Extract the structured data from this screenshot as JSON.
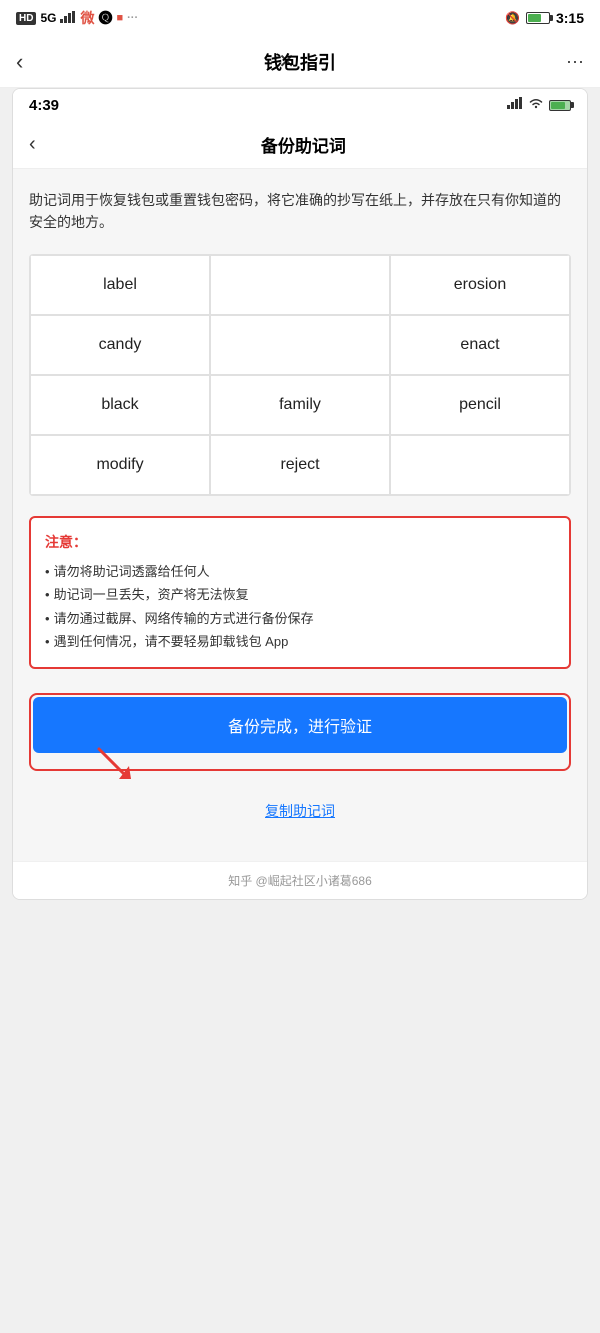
{
  "outer": {
    "status": {
      "time": "3:15",
      "indicators": [
        "HD",
        "5G",
        "signal"
      ]
    },
    "nav": {
      "title": "钱包指引",
      "back_label": "‹",
      "close_label": "✕",
      "more_label": "···"
    }
  },
  "inner": {
    "status": {
      "time": "4:39"
    },
    "nav": {
      "title": "备份助记词",
      "back_label": "‹"
    },
    "description": "助记词用于恢复钱包或重置钱包密码，将它准确的抄写在纸上，并存放在只有你知道的安全的地方。",
    "mnemonic_words": [
      {
        "word": "label",
        "col": 0
      },
      {
        "word": "",
        "col": 1
      },
      {
        "word": "erosion",
        "col": 2
      },
      {
        "word": "candy",
        "col": 0
      },
      {
        "word": "",
        "col": 1
      },
      {
        "word": "enact",
        "col": 2
      },
      {
        "word": "black",
        "col": 0
      },
      {
        "word": "family",
        "col": 1
      },
      {
        "word": "pencil",
        "col": 2
      },
      {
        "word": "modify",
        "col": 0
      },
      {
        "word": "reject",
        "col": 1
      },
      {
        "word": "",
        "col": 2
      }
    ],
    "warning": {
      "title": "注意：",
      "items": [
        "请勿将助记词透露给任何人",
        "助记词一旦丢失，资产将无法恢复",
        "请勿通过截屏、网络传输的方式进行备份保存",
        "遇到任何情况，请不要轻易卸载钱包 App"
      ]
    },
    "primary_button": "备份完成，进行验证",
    "copy_link": "复制助记词"
  },
  "footer": {
    "text": "知乎 @崛起社区小诸葛686"
  }
}
